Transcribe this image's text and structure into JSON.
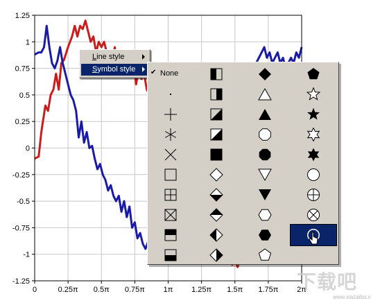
{
  "chart_data": {
    "type": "line",
    "title": "",
    "xlabel": "",
    "ylabel": "",
    "xlim": [
      0,
      2
    ],
    "ylim": [
      -1.25,
      1.25
    ],
    "grid": true,
    "x_tick_labels": [
      "0",
      "0.25π",
      "0.5π",
      "0.75π",
      "1π",
      "1.25π",
      "1.5π",
      "1.75π",
      "2π"
    ],
    "y_tick_labels": [
      "1.25",
      "1",
      "0.75",
      "0.5",
      "0.25",
      "0",
      "-0.25",
      "-0.5",
      "-0.75",
      "-1",
      "-1.25"
    ],
    "series": [
      {
        "color": "#cc1b1b",
        "x": [
          0,
          0.03,
          0.05,
          0.08,
          0.1,
          0.12,
          0.14,
          0.16,
          0.18,
          0.2,
          0.22,
          0.25,
          0.28,
          0.3,
          0.32,
          0.34,
          0.36,
          0.38,
          0.4,
          0.42,
          0.44,
          0.46,
          0.48,
          0.5,
          0.52,
          0.54,
          0.56,
          0.58,
          0.6,
          0.62,
          0.64,
          0.66,
          0.68,
          0.7,
          0.72,
          0.74,
          0.76,
          0.78,
          0.8,
          0.82,
          0.84,
          0.86,
          0.88,
          0.9,
          0.92,
          0.94,
          0.96,
          1.4,
          1.42,
          1.44,
          1.46,
          1.48,
          1.5,
          1.52,
          1.54,
          1.56,
          1.58,
          1.6
        ],
        "y": [
          -0.1,
          -0.08,
          0.15,
          0.4,
          0.35,
          0.5,
          0.55,
          0.7,
          0.55,
          0.8,
          0.83,
          0.95,
          1.05,
          1.15,
          1.05,
          1.15,
          1.12,
          1.2,
          1.1,
          1.0,
          1.05,
          0.9,
          1.0,
          0.95,
          1.0,
          0.9,
          0.75,
          0.8,
          0.95,
          0.8,
          0.85,
          0.82,
          0.9,
          0.7,
          0.85,
          0.8,
          0.6,
          0.75,
          0.65,
          0.7,
          0.55,
          0.5,
          0.55,
          0.45,
          0.5,
          0.35,
          0.3,
          -1.0,
          -1.05,
          -1.08,
          -1.02,
          -1.1,
          -1.05,
          -1.12,
          -1.05,
          -1.0,
          -0.95,
          -0.9
        ]
      },
      {
        "color": "#1a1aa8",
        "x": [
          0,
          0.03,
          0.05,
          0.07,
          0.09,
          0.11,
          0.13,
          0.15,
          0.17,
          0.19,
          0.21,
          0.23,
          0.25,
          0.27,
          0.29,
          0.31,
          0.33,
          0.35,
          0.37,
          0.39,
          0.41,
          0.43,
          0.45,
          0.47,
          0.49,
          0.51,
          0.53,
          0.55,
          0.57,
          0.59,
          0.61,
          0.63,
          0.65,
          0.67,
          0.69,
          0.71,
          0.73,
          0.75,
          0.77,
          0.79,
          0.81,
          0.83,
          0.85,
          0.87,
          0.89,
          0.91,
          0.93,
          1.7,
          1.72,
          1.74,
          1.76,
          1.78,
          1.8,
          1.82,
          1.84,
          1.86,
          1.88,
          1.9,
          1.92,
          1.94,
          1.96,
          1.98,
          2.0
        ],
        "y": [
          0.88,
          0.9,
          0.9,
          0.95,
          1.15,
          0.95,
          0.8,
          0.75,
          0.82,
          0.95,
          0.8,
          0.7,
          0.6,
          0.5,
          0.45,
          0.35,
          0.1,
          0.25,
          0.05,
          0.15,
          0.0,
          0.02,
          -0.1,
          -0.2,
          -0.15,
          -0.25,
          -0.3,
          -0.4,
          -0.35,
          -0.45,
          -0.5,
          -0.45,
          -0.6,
          -0.5,
          -0.65,
          -0.55,
          -0.75,
          -0.7,
          -0.85,
          -0.8,
          -0.9,
          -0.95,
          -0.88,
          -1.0,
          -0.95,
          -1.05,
          -1.0,
          0.9,
          0.95,
          0.85,
          0.9,
          0.8,
          0.85,
          0.9,
          0.8,
          0.85,
          0.75,
          0.8,
          0.85,
          0.8,
          0.9,
          0.85,
          0.95
        ]
      }
    ]
  },
  "context_menu": {
    "items": [
      {
        "underline": "L",
        "rest": "ine style"
      },
      {
        "underline": "S",
        "rest": "ymbol style"
      }
    ],
    "selected_index": 1
  },
  "symbol_palette": {
    "none_label": "None",
    "check": "✔",
    "selected_index": 38,
    "columns": [
      [
        "none",
        "dot",
        "plus",
        "star6",
        "x",
        "square",
        "square-plus",
        "square-x",
        "square-half-top",
        "square-half-bottom"
      ],
      [
        "square-half-left",
        "square-half-right",
        "square-tri-bl",
        "square-tri-br",
        "square-filled",
        "diamond",
        "diamond-half-bottom",
        "diamond-half-top",
        "diamond-half-left",
        "diamond-half-right"
      ],
      [
        "diamond-filled",
        "triangle-up",
        "triangle-up-filled",
        "octagon",
        "octagon-filled",
        "triangle-down",
        "triangle-down-filled",
        "hexagon",
        "hexagon-filled",
        "pentagon"
      ],
      [
        "pentagon-filled",
        "star5",
        "star5-filled",
        "star6-outline",
        "star6-filled",
        "circle",
        "circle-plus",
        "circle-x",
        "circle-filled",
        "none"
      ]
    ]
  },
  "watermark": {
    "text": "下载吧",
    "sub": "www.xiazaiba.com"
  }
}
